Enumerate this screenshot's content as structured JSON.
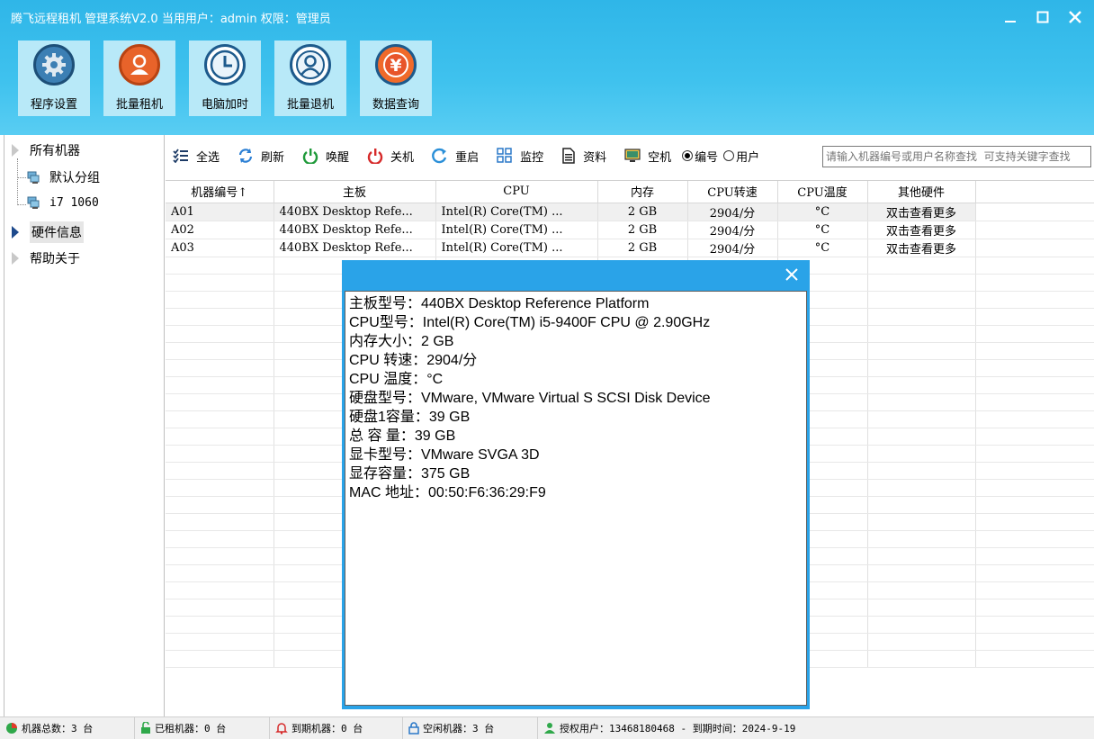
{
  "window": {
    "title": "腾飞远程租机 管理系统V2.0    当用用户：admin  权限：管理员"
  },
  "tiles": [
    {
      "label": "程序设置",
      "icon": "gear-icon"
    },
    {
      "label": "批量租机",
      "icon": "user-icon"
    },
    {
      "label": "电脑加时",
      "icon": "clock-icon"
    },
    {
      "label": "批量退机",
      "icon": "user-outline-icon"
    },
    {
      "label": "数据查询",
      "icon": "yen-icon"
    }
  ],
  "tree": {
    "all_machines": "所有机器",
    "default_group": "默认分组",
    "i7_group": "i7 1060",
    "hardware_info": "硬件信息",
    "help_about": "帮助关于"
  },
  "toolbar": {
    "select_all": "全选",
    "refresh": "刷新",
    "wake": "唤醒",
    "shutdown": "关机",
    "restart": "重启",
    "monitor": "监控",
    "info": "资料",
    "idle": "空机",
    "radio_number": "编号",
    "radio_user": "用户",
    "search_placeholder": "请输入机器编号或用户名称查找  可支持关键字查找"
  },
  "grid": {
    "headers": [
      "机器编号↑",
      "主板",
      "CPU",
      "内存",
      "CPU转速",
      "CPU温度",
      "其他硬件"
    ],
    "rows": [
      [
        "A01",
        "440BX Desktop Refe...",
        "Intel(R) Core(TM) ...",
        "2 GB",
        "2904/分",
        "°C",
        "双击查看更多"
      ],
      [
        "A02",
        "440BX Desktop Refe...",
        "Intel(R) Core(TM) ...",
        "2 GB",
        "2904/分",
        "°C",
        "双击查看更多"
      ],
      [
        "A03",
        "440BX Desktop Refe...",
        "Intel(R) Core(TM) ...",
        "2 GB",
        "2904/分",
        "°C",
        "双击查看更多"
      ]
    ]
  },
  "popup": {
    "lines": [
      "主板型号：440BX Desktop Reference Platform",
      "CPU型号：Intel(R) Core(TM) i5-9400F CPU @ 2.90GHz",
      "内存大小：2 GB",
      "CPU 转速：2904/分",
      "CPU 温度：°C",
      "硬盘型号：VMware, VMware Virtual S SCSI Disk Device",
      "硬盘1容量：39 GB",
      "总 容 量：39 GB",
      "显卡型号：VMware SVGA 3D",
      "显存容量：375 GB",
      "MAC 地址：00:50:F6:36:29:F9"
    ]
  },
  "status": {
    "total": "机器总数：3 台",
    "rented": "已租机器：0 台",
    "expired": "到期机器：0 台",
    "idle": "空闲机器：3 台",
    "license": "授权用户：13468180468 - 到期时间：2024-9-19"
  },
  "colors": {
    "header_top": "#2fb6e8",
    "tile_bg": "#b8e9f8",
    "popup_border": "#2aa3e8"
  }
}
